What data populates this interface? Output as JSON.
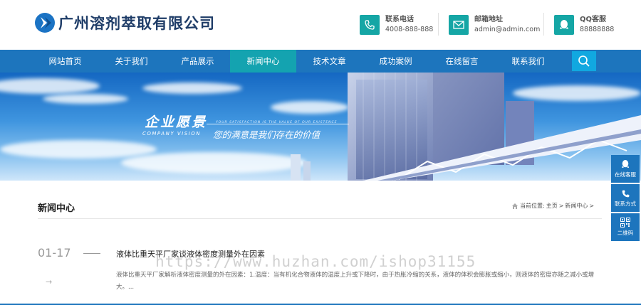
{
  "header": {
    "company_name": "广州溶剂萃取有限公司",
    "contacts": [
      {
        "label": "联系电话",
        "value": "4008-888-888",
        "icon": "phone-icon"
      },
      {
        "label": "邮箱地址",
        "value": "admin@admin.com",
        "icon": "mail-icon"
      },
      {
        "label": "QQ客服",
        "value": "88888888",
        "icon": "qq-icon"
      }
    ]
  },
  "nav": {
    "items": [
      "网站首页",
      "关于我们",
      "产品展示",
      "新闻中心",
      "技术文章",
      "成功案例",
      "在线留言",
      "联系我们"
    ],
    "active_index": 3,
    "search_icon": "search-icon"
  },
  "banner": {
    "title": "企业愿景",
    "title_en": "COMPANY VISION",
    "tagline_en": "YOUR SATISFACTION IS THE VALUE OF OUR EXISTENCE",
    "tagline": "您的满意是我们存在的价值"
  },
  "section": {
    "title": "新闻中心",
    "breadcrumb": {
      "prefix": "当前位置:",
      "home": "主页",
      "sep1": ">",
      "current": "新闻中心",
      "sep2": ">"
    }
  },
  "news": [
    {
      "date": "01-17",
      "title": "液体比重天平厂家谈液体密度测量外在因素",
      "summary": "液体比重天平厂家解析液体密度测量的外在因素：1.温度：当有机化合物液体的温度上升或下降时，由于热胀冷缩的关系，液体的体积会膨胀或缩小，则液体的密度亦随之减小或增大。...",
      "arrow": "→"
    }
  ],
  "watermark": "https://www.huzhan.com/ishop31155",
  "side_widget": [
    {
      "label": "在线客服",
      "icon": "qq-icon"
    },
    {
      "label": "联系方式",
      "icon": "phone-icon"
    },
    {
      "label": "二维码",
      "icon": "qrcode-icon"
    }
  ],
  "colors": {
    "nav_bg": "#1d75bd",
    "nav_active": "#14a3b0",
    "icon_teal": "#15a6a5",
    "logo_text": "#1f3d68",
    "search_bg": "#11a8e0"
  }
}
